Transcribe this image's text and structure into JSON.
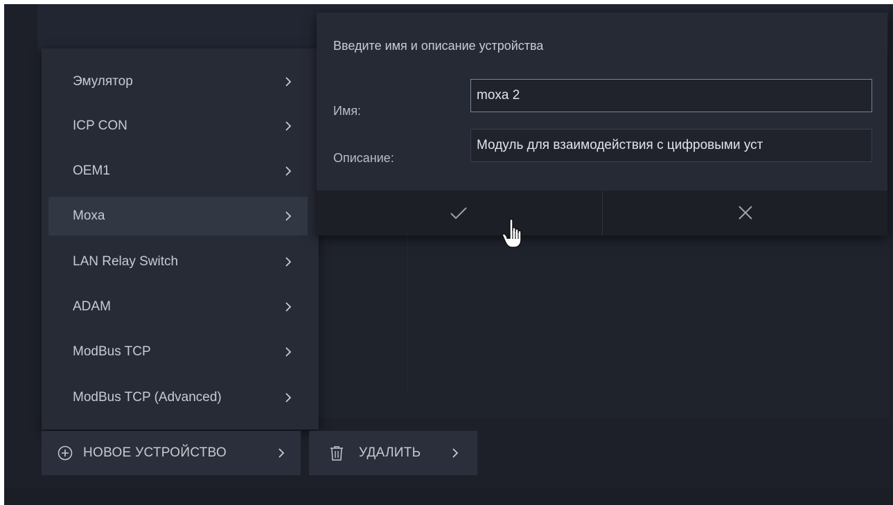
{
  "device_menu": {
    "items": [
      {
        "label": "Эмулятор",
        "active": false
      },
      {
        "label": "ICP CON",
        "active": false
      },
      {
        "label": "OEM1",
        "active": false
      },
      {
        "label": "Moxa",
        "active": true
      },
      {
        "label": "LAN Relay Switch",
        "active": false
      },
      {
        "label": "ADAM",
        "active": false
      },
      {
        "label": "ModBus TCP",
        "active": false
      },
      {
        "label": "ModBus TCP (Advanced)",
        "active": false
      }
    ]
  },
  "toolbar": {
    "new_device_label": "НОВОЕ УСТРОЙСТВО",
    "new_device_icon": "plus-circle-icon",
    "delete_label": "УДАЛИТЬ",
    "delete_icon": "trash-icon"
  },
  "dialog": {
    "title": "Введите имя и описание устройства",
    "name_label": "Имя:",
    "name_value": "moxa 2",
    "description_label": "Описание:",
    "description_value": "Модуль для взаимодействия с цифровыми уст",
    "confirm_icon": "checkmark-icon",
    "cancel_icon": "close-icon"
  },
  "colors": {
    "background": "#1d2029",
    "menu_background": "#272b36",
    "menu_active": "#323744",
    "button_background": "#2b2f3b",
    "dialog_background": "#262a35",
    "text": "#c9ccd3"
  }
}
